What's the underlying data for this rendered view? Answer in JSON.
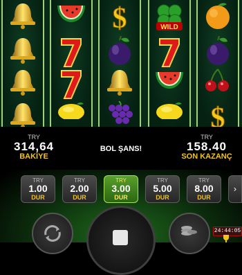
{
  "balance": {
    "currency": "TRY",
    "amount": "314,64",
    "label": "BAKİYE"
  },
  "message": "BOL ŞANS!",
  "last_win": {
    "currency": "TRY",
    "amount": "158.40",
    "label": "SON KAZANÇ"
  },
  "bets": [
    {
      "currency": "TRY",
      "value": "1.00",
      "label": "DUR",
      "active": false
    },
    {
      "currency": "TRY",
      "value": "2.00",
      "label": "DUR",
      "active": false
    },
    {
      "currency": "TRY",
      "value": "3.00",
      "label": "DUR",
      "active": true
    },
    {
      "currency": "TRY",
      "value": "5.00",
      "label": "DUR",
      "active": false
    },
    {
      "currency": "TRY",
      "value": "8.00",
      "label": "DUR",
      "active": false
    }
  ],
  "more_bets_icon": "chevron-right-icon",
  "timer": "24:44:05",
  "reels": [
    [
      "bell",
      "bell",
      "bell",
      "bell"
    ],
    [
      "watermelon",
      "seven",
      "seven",
      "lemon"
    ],
    [
      "dollar",
      "plum",
      "bell",
      "grapes"
    ],
    [
      "clover-wild",
      "seven",
      "watermelon",
      "lemon"
    ],
    [
      "orange",
      "plum",
      "cherries",
      "dollar"
    ]
  ],
  "wild_text": "WILD",
  "colors": {
    "accent_green": "#5aa02a",
    "gold": "#f3c51a",
    "reel_border": "#9fd27a"
  }
}
